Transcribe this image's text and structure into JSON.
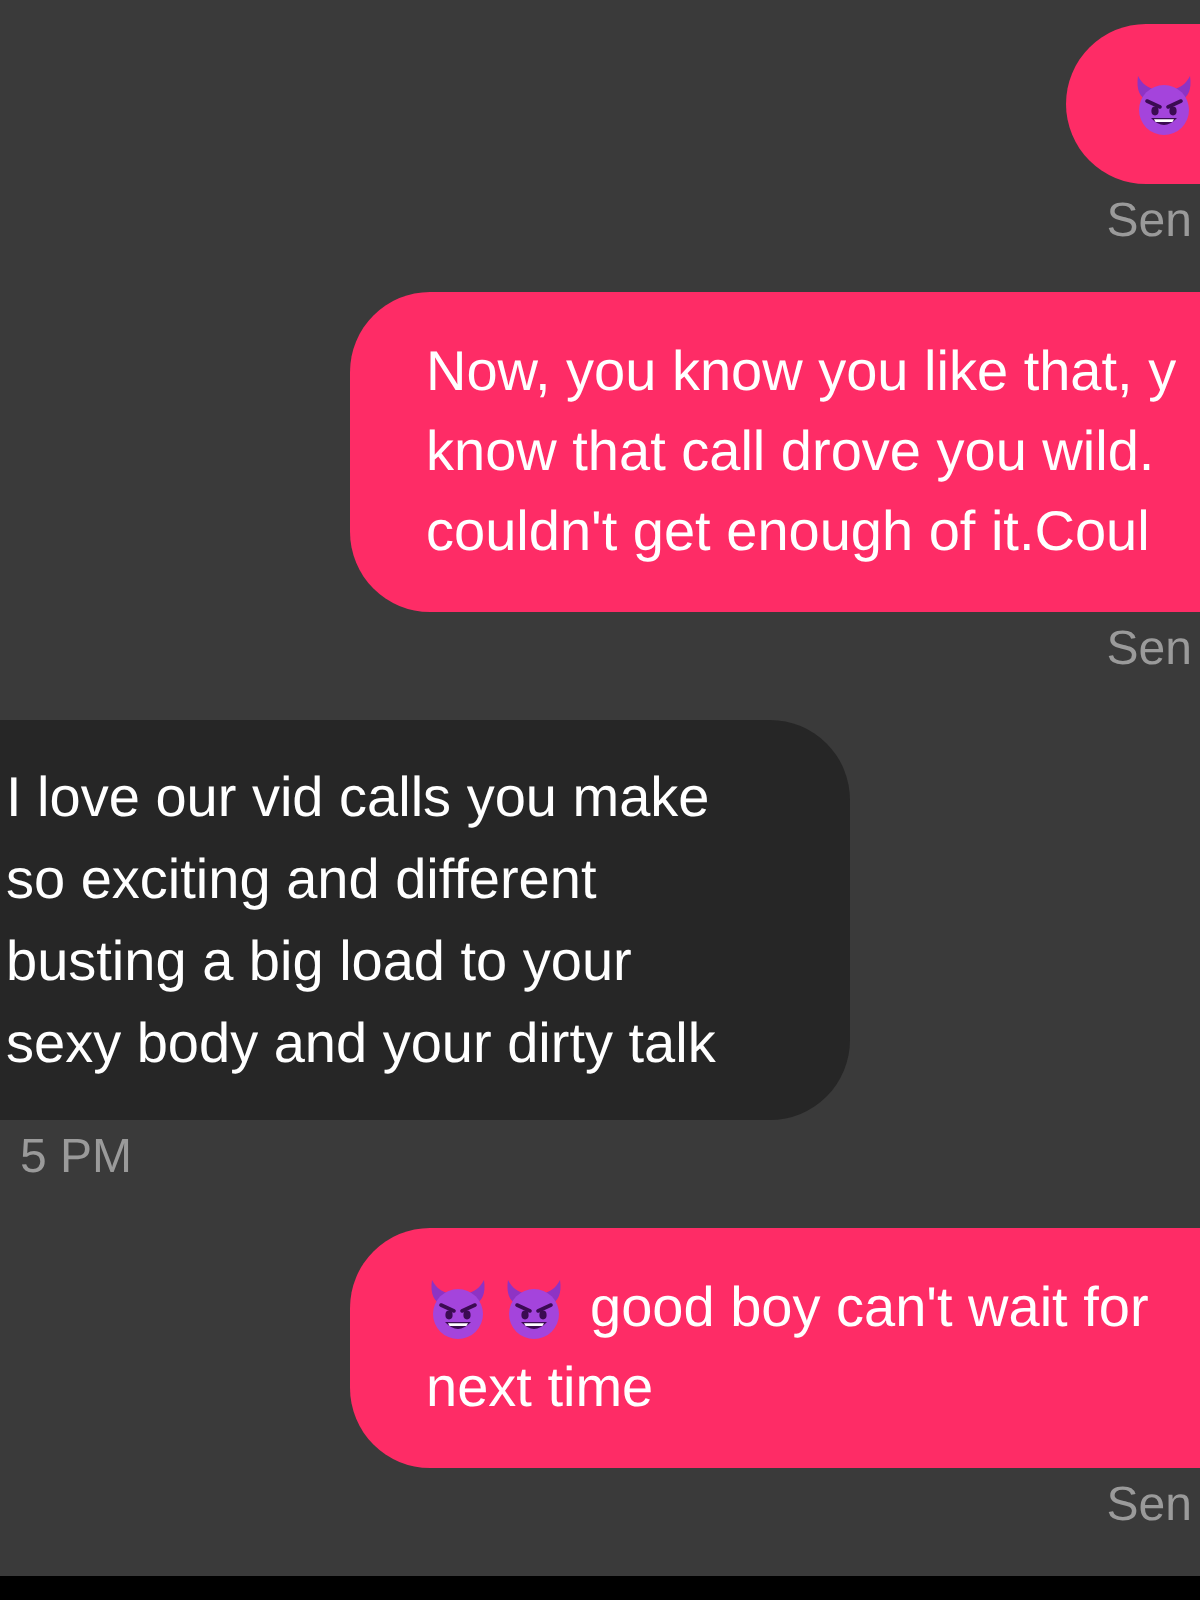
{
  "messages": [
    {
      "kind": "sent",
      "content": [
        {
          "kind": "emoji"
        }
      ],
      "timestamp": "Sen"
    },
    {
      "kind": "sent",
      "content": [
        {
          "kind": "text",
          "text": "Now, you know you like that, y\nknow that call drove you wild.\ncouldn't get enough of it.Coul"
        }
      ],
      "timestamp": "Sen"
    },
    {
      "kind": "received",
      "content": [
        {
          "kind": "text",
          "text": "I love our vid calls you make\nso exciting and different\nbusting a big load to your\nsexy body and your dirty talk"
        }
      ],
      "timestamp": "5 PM"
    },
    {
      "kind": "sent",
      "content": [
        {
          "kind": "emoji"
        },
        {
          "kind": "emoji"
        },
        {
          "kind": "text",
          "text": "good boy can't wait for"
        },
        {
          "kind": "text",
          "text": "next time"
        }
      ],
      "timestamp": "Sen"
    }
  ]
}
